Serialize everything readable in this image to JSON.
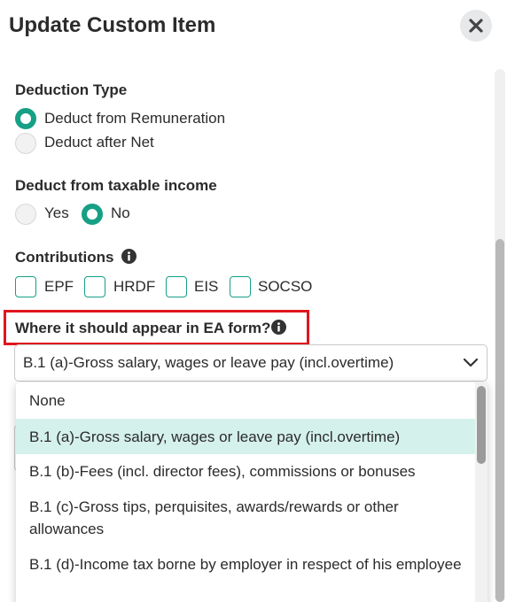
{
  "header": {
    "title": "Update Custom Item"
  },
  "deduction_type": {
    "label": "Deduction Type",
    "options": [
      {
        "label": "Deduct from Remuneration",
        "checked": true
      },
      {
        "label": "Deduct after Net",
        "checked": false
      }
    ]
  },
  "taxable_income": {
    "label": "Deduct from taxable income",
    "options": [
      {
        "label": "Yes",
        "checked": false
      },
      {
        "label": "No",
        "checked": true
      }
    ]
  },
  "contributions": {
    "label": "Contributions",
    "items": [
      {
        "label": "EPF",
        "checked": false
      },
      {
        "label": "HRDF",
        "checked": false
      },
      {
        "label": "EIS",
        "checked": false
      },
      {
        "label": "SOCSO",
        "checked": false
      }
    ]
  },
  "ea_form": {
    "label": "Where it should appear in EA form?",
    "selected": "B.1 (a)-Gross salary, wages or leave pay (incl.overtime)",
    "options": [
      "None",
      "B.1 (a)-Gross salary, wages or leave pay (incl.overtime)",
      "B.1 (b)-Fees (incl. director fees), commissions or bonuses",
      "B.1 (c)-Gross tips, perquisites, awards/rewards or other allowances",
      "B.1 (d)-Income tax borne by employer in respect of his employee"
    ]
  },
  "colors": {
    "accent": "#16a085",
    "highlight": "#e0161e",
    "selected_bg": "#d5f1ec"
  }
}
